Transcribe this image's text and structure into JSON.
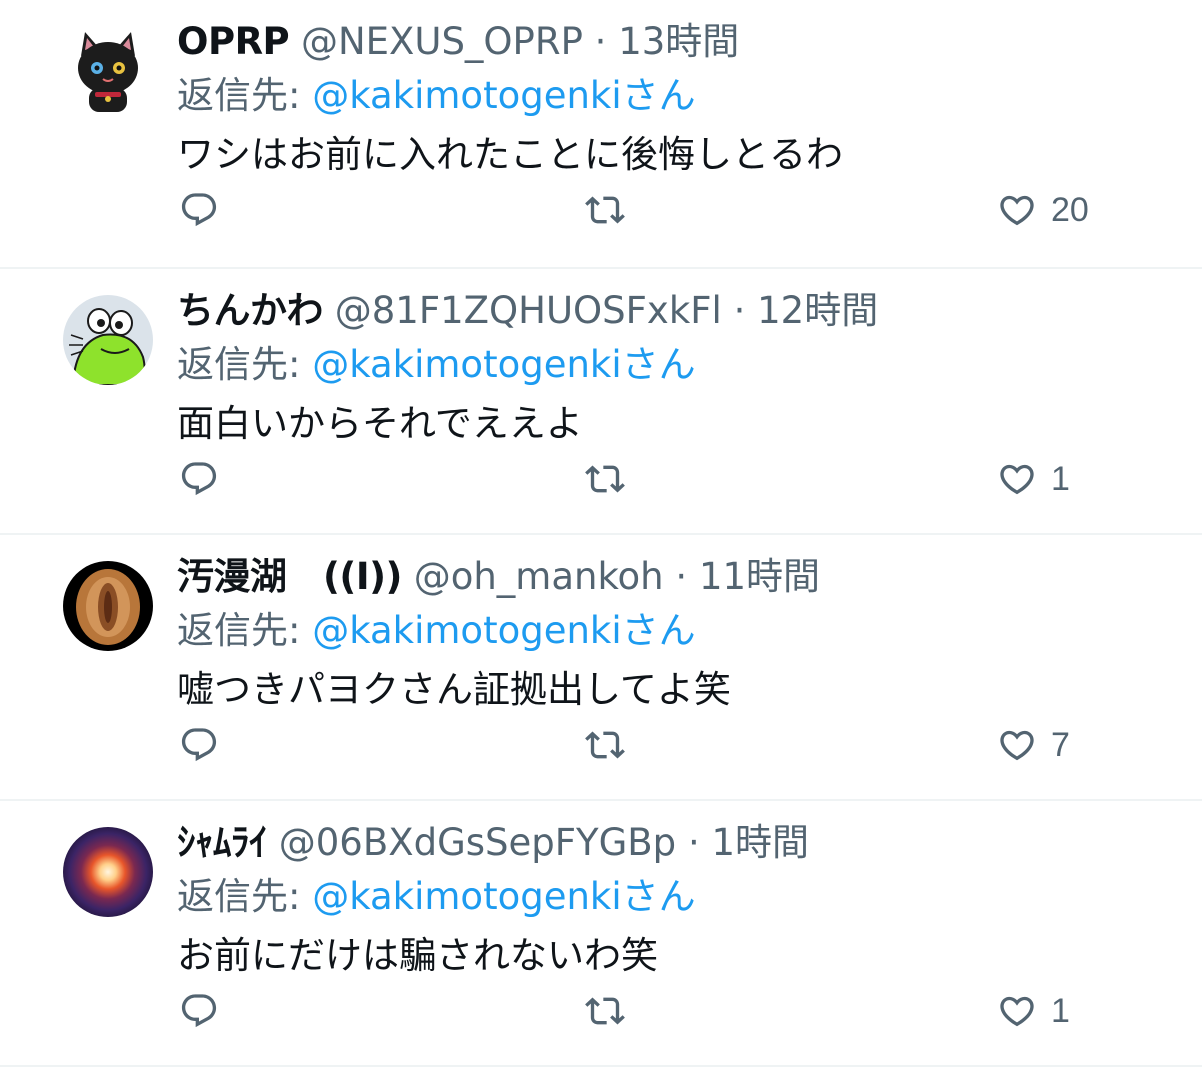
{
  "colors": {
    "accent": "#1d9bf0",
    "secondary_text": "#536471",
    "primary_text": "#0f1419",
    "divider": "#eff3f4"
  },
  "tweets": [
    {
      "display_name": "OPRP",
      "handle": "@NEXUS_OPRP",
      "separator": "·",
      "time": "13時間",
      "reply_prefix": "返信先:",
      "reply_to": "@kakimotogenkiさん",
      "text": "ワシはお前に入れたことに後悔しとるわ",
      "likes": "20",
      "avatar_icon": "black-cat-avatar"
    },
    {
      "display_name": "ちんかわ",
      "handle": "@81F1ZQHUOSFxkFl",
      "separator": "·",
      "time": "12時間",
      "reply_prefix": "返信先:",
      "reply_to": "@kakimotogenkiさん",
      "text": "面白いからそれでええよ",
      "likes": "1",
      "avatar_icon": "green-frog-avatar"
    },
    {
      "display_name": "汚漫湖　((I))",
      "handle": "@oh_mankoh",
      "separator": "·",
      "time": "11時間",
      "reply_prefix": "返信先:",
      "reply_to": "@kakimotogenkiさん",
      "text": "嘘つきパヨクさん証拠出してよ笑",
      "likes": "7",
      "avatar_icon": "photo-avatar"
    },
    {
      "display_name": "ｼｬﾑﾗｲ",
      "handle": "@06BXdGsSepFYGBp",
      "separator": "·",
      "time": "1時間",
      "reply_prefix": "返信先:",
      "reply_to": "@kakimotogenkiさん",
      "text": "お前にだけは騙されないわ笑",
      "likes": "1",
      "avatar_icon": "sun-orb-avatar"
    }
  ]
}
